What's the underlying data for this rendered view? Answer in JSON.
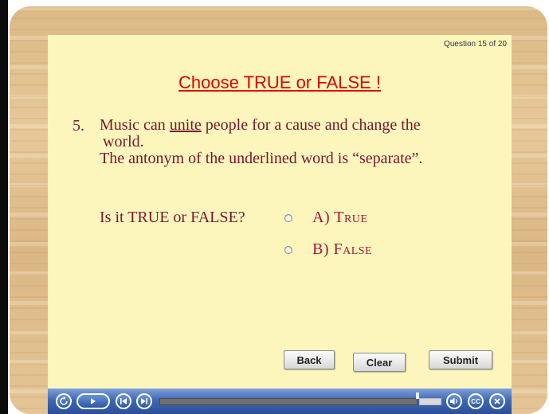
{
  "quiz": {
    "counter": "Question 15 of 20",
    "title": "Choose TRUE or FALSE !",
    "question_number": "5.",
    "question_line1_before": "Music can ",
    "question_underlined": "unite",
    "question_line1_after": " people for a cause and change the",
    "question_line2": "world.",
    "question_line3": "The antonym of the underlined word is “separate”.",
    "prompt": "Is it TRUE or FALSE?",
    "options": [
      {
        "label": "A) True",
        "selected": false
      },
      {
        "label": "B) False",
        "selected": false
      }
    ]
  },
  "buttons": {
    "back": "Back",
    "clear": "Clear",
    "submit": "Submit"
  },
  "player": {
    "icons": [
      "replay-icon",
      "play-icon",
      "previous-icon",
      "next-icon",
      "volume-icon",
      "cc-icon",
      "close-icon"
    ],
    "cc_label": "CC"
  }
}
